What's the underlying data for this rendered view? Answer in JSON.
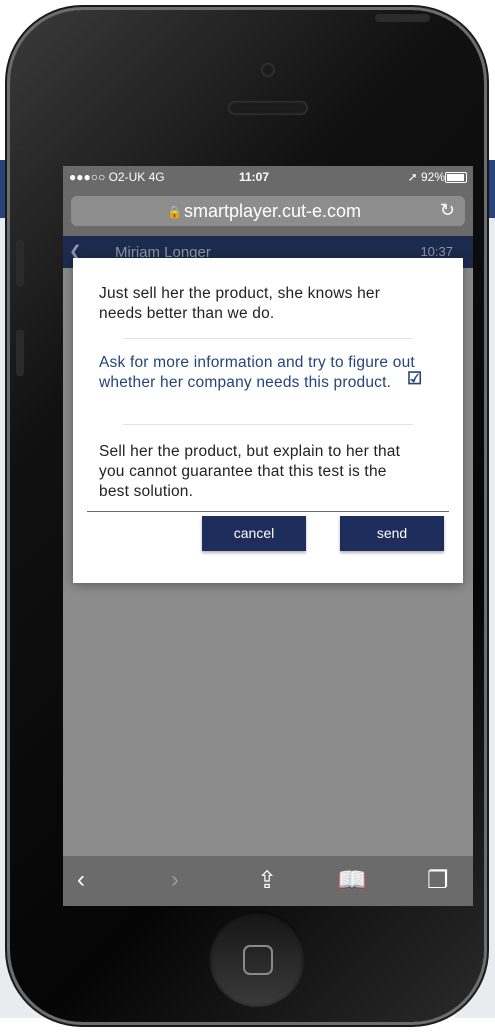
{
  "status_bar": {
    "carrier": "●●●○○ O2-UK  4G",
    "time": "11:07",
    "battery": "➚ 92%"
  },
  "address_bar": {
    "url": "smartplayer.cut-e.com",
    "lock_icon": "lock-icon",
    "reload_icon": "reload-icon"
  },
  "chat_header": {
    "name": "Miriam Longer",
    "time": "10:37"
  },
  "dialog": {
    "options": [
      {
        "text": "Just sell her the product, she knows her needs better than we do.",
        "selected": false
      },
      {
        "text": "Ask for more information and try to figure out whether her company needs this product.",
        "selected": true
      },
      {
        "text": "Sell her the product, but explain to her that you cannot guarantee that this test is the best solution.",
        "selected": false
      }
    ],
    "cancel_label": "cancel",
    "send_label": "send"
  },
  "toolbar": {
    "back": "‹",
    "forward": "›",
    "share": "⇪",
    "bookmarks": "📖",
    "tabs": "❐"
  },
  "colors": {
    "accent": "#26447a",
    "button": "#1e2d5c"
  }
}
